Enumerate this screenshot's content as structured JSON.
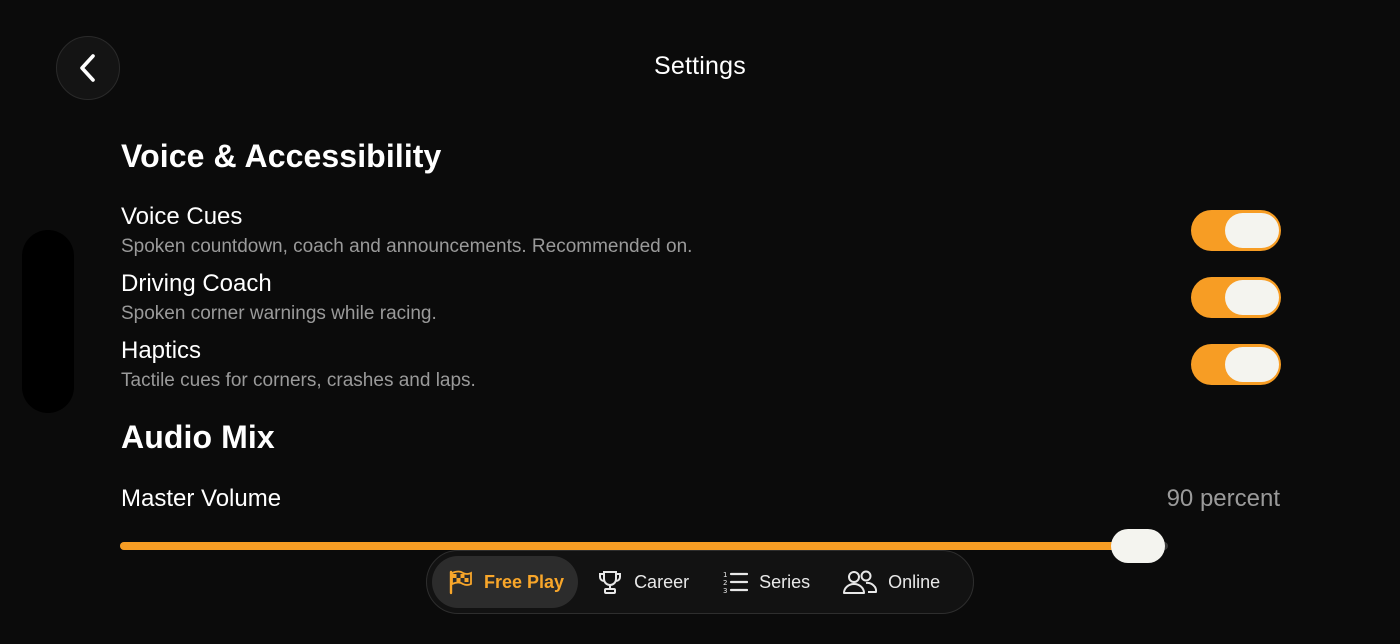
{
  "header": {
    "title": "Settings",
    "back_icon": "chevron-left-icon"
  },
  "colors": {
    "accent": "#f79d24",
    "background": "#0b0b0b",
    "muted_text": "#9a9a9a"
  },
  "voice_section": {
    "title": "Voice & Accessibility",
    "settings": [
      {
        "label": "Voice Cues",
        "description": "Spoken countdown, coach and announcements. Recommended on.",
        "enabled": true
      },
      {
        "label": "Driving Coach",
        "description": "Spoken corner warnings while racing.",
        "enabled": true
      },
      {
        "label": "Haptics",
        "description": "Tactile cues for corners, crashes and laps.",
        "enabled": true
      }
    ]
  },
  "audio_section": {
    "title": "Audio Mix",
    "master_volume": {
      "label": "Master Volume",
      "value_text": "90 percent",
      "value": 0.9
    }
  },
  "tabbar": {
    "tabs": [
      {
        "label": "Free Play",
        "icon": "checkered-flag-icon",
        "active": true
      },
      {
        "label": "Career",
        "icon": "trophy-icon",
        "active": false
      },
      {
        "label": "Series",
        "icon": "numbered-list-icon",
        "active": false
      },
      {
        "label": "Online",
        "icon": "users-icon",
        "active": false
      }
    ]
  }
}
